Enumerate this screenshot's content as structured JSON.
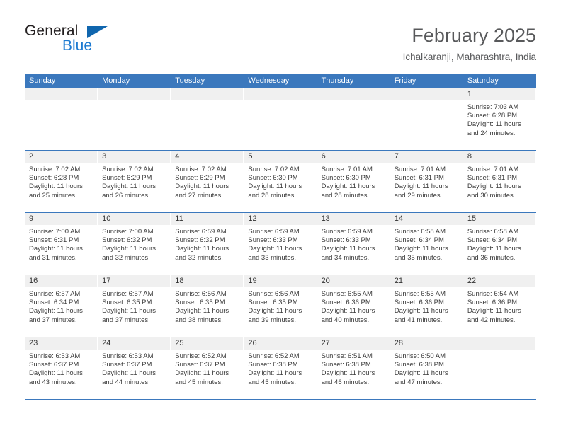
{
  "brand": {
    "name_part1": "General",
    "name_part2": "Blue",
    "triangle_color": "#1066ae",
    "blue_color": "#1c7ad1"
  },
  "header": {
    "title": "February 2025",
    "location": "Ichalkaranji, Maharashtra, India",
    "accent_color": "#3b78bd",
    "title_color": "#58595b"
  },
  "calendar": {
    "weekday_headers": [
      "Sunday",
      "Monday",
      "Tuesday",
      "Wednesday",
      "Thursday",
      "Friday",
      "Saturday"
    ],
    "weeks": [
      [
        {
          "day": "",
          "sunrise": "",
          "sunset": "",
          "daylight1": "",
          "daylight2": ""
        },
        {
          "day": "",
          "sunrise": "",
          "sunset": "",
          "daylight1": "",
          "daylight2": ""
        },
        {
          "day": "",
          "sunrise": "",
          "sunset": "",
          "daylight1": "",
          "daylight2": ""
        },
        {
          "day": "",
          "sunrise": "",
          "sunset": "",
          "daylight1": "",
          "daylight2": ""
        },
        {
          "day": "",
          "sunrise": "",
          "sunset": "",
          "daylight1": "",
          "daylight2": ""
        },
        {
          "day": "",
          "sunrise": "",
          "sunset": "",
          "daylight1": "",
          "daylight2": ""
        },
        {
          "day": "1",
          "sunrise": "Sunrise: 7:03 AM",
          "sunset": "Sunset: 6:28 PM",
          "daylight1": "Daylight: 11 hours",
          "daylight2": "and 24 minutes."
        }
      ],
      [
        {
          "day": "2",
          "sunrise": "Sunrise: 7:02 AM",
          "sunset": "Sunset: 6:28 PM",
          "daylight1": "Daylight: 11 hours",
          "daylight2": "and 25 minutes."
        },
        {
          "day": "3",
          "sunrise": "Sunrise: 7:02 AM",
          "sunset": "Sunset: 6:29 PM",
          "daylight1": "Daylight: 11 hours",
          "daylight2": "and 26 minutes."
        },
        {
          "day": "4",
          "sunrise": "Sunrise: 7:02 AM",
          "sunset": "Sunset: 6:29 PM",
          "daylight1": "Daylight: 11 hours",
          "daylight2": "and 27 minutes."
        },
        {
          "day": "5",
          "sunrise": "Sunrise: 7:02 AM",
          "sunset": "Sunset: 6:30 PM",
          "daylight1": "Daylight: 11 hours",
          "daylight2": "and 28 minutes."
        },
        {
          "day": "6",
          "sunrise": "Sunrise: 7:01 AM",
          "sunset": "Sunset: 6:30 PM",
          "daylight1": "Daylight: 11 hours",
          "daylight2": "and 28 minutes."
        },
        {
          "day": "7",
          "sunrise": "Sunrise: 7:01 AM",
          "sunset": "Sunset: 6:31 PM",
          "daylight1": "Daylight: 11 hours",
          "daylight2": "and 29 minutes."
        },
        {
          "day": "8",
          "sunrise": "Sunrise: 7:01 AM",
          "sunset": "Sunset: 6:31 PM",
          "daylight1": "Daylight: 11 hours",
          "daylight2": "and 30 minutes."
        }
      ],
      [
        {
          "day": "9",
          "sunrise": "Sunrise: 7:00 AM",
          "sunset": "Sunset: 6:31 PM",
          "daylight1": "Daylight: 11 hours",
          "daylight2": "and 31 minutes."
        },
        {
          "day": "10",
          "sunrise": "Sunrise: 7:00 AM",
          "sunset": "Sunset: 6:32 PM",
          "daylight1": "Daylight: 11 hours",
          "daylight2": "and 32 minutes."
        },
        {
          "day": "11",
          "sunrise": "Sunrise: 6:59 AM",
          "sunset": "Sunset: 6:32 PM",
          "daylight1": "Daylight: 11 hours",
          "daylight2": "and 32 minutes."
        },
        {
          "day": "12",
          "sunrise": "Sunrise: 6:59 AM",
          "sunset": "Sunset: 6:33 PM",
          "daylight1": "Daylight: 11 hours",
          "daylight2": "and 33 minutes."
        },
        {
          "day": "13",
          "sunrise": "Sunrise: 6:59 AM",
          "sunset": "Sunset: 6:33 PM",
          "daylight1": "Daylight: 11 hours",
          "daylight2": "and 34 minutes."
        },
        {
          "day": "14",
          "sunrise": "Sunrise: 6:58 AM",
          "sunset": "Sunset: 6:34 PM",
          "daylight1": "Daylight: 11 hours",
          "daylight2": "and 35 minutes."
        },
        {
          "day": "15",
          "sunrise": "Sunrise: 6:58 AM",
          "sunset": "Sunset: 6:34 PM",
          "daylight1": "Daylight: 11 hours",
          "daylight2": "and 36 minutes."
        }
      ],
      [
        {
          "day": "16",
          "sunrise": "Sunrise: 6:57 AM",
          "sunset": "Sunset: 6:34 PM",
          "daylight1": "Daylight: 11 hours",
          "daylight2": "and 37 minutes."
        },
        {
          "day": "17",
          "sunrise": "Sunrise: 6:57 AM",
          "sunset": "Sunset: 6:35 PM",
          "daylight1": "Daylight: 11 hours",
          "daylight2": "and 37 minutes."
        },
        {
          "day": "18",
          "sunrise": "Sunrise: 6:56 AM",
          "sunset": "Sunset: 6:35 PM",
          "daylight1": "Daylight: 11 hours",
          "daylight2": "and 38 minutes."
        },
        {
          "day": "19",
          "sunrise": "Sunrise: 6:56 AM",
          "sunset": "Sunset: 6:35 PM",
          "daylight1": "Daylight: 11 hours",
          "daylight2": "and 39 minutes."
        },
        {
          "day": "20",
          "sunrise": "Sunrise: 6:55 AM",
          "sunset": "Sunset: 6:36 PM",
          "daylight1": "Daylight: 11 hours",
          "daylight2": "and 40 minutes."
        },
        {
          "day": "21",
          "sunrise": "Sunrise: 6:55 AM",
          "sunset": "Sunset: 6:36 PM",
          "daylight1": "Daylight: 11 hours",
          "daylight2": "and 41 minutes."
        },
        {
          "day": "22",
          "sunrise": "Sunrise: 6:54 AM",
          "sunset": "Sunset: 6:36 PM",
          "daylight1": "Daylight: 11 hours",
          "daylight2": "and 42 minutes."
        }
      ],
      [
        {
          "day": "23",
          "sunrise": "Sunrise: 6:53 AM",
          "sunset": "Sunset: 6:37 PM",
          "daylight1": "Daylight: 11 hours",
          "daylight2": "and 43 minutes."
        },
        {
          "day": "24",
          "sunrise": "Sunrise: 6:53 AM",
          "sunset": "Sunset: 6:37 PM",
          "daylight1": "Daylight: 11 hours",
          "daylight2": "and 44 minutes."
        },
        {
          "day": "25",
          "sunrise": "Sunrise: 6:52 AM",
          "sunset": "Sunset: 6:37 PM",
          "daylight1": "Daylight: 11 hours",
          "daylight2": "and 45 minutes."
        },
        {
          "day": "26",
          "sunrise": "Sunrise: 6:52 AM",
          "sunset": "Sunset: 6:38 PM",
          "daylight1": "Daylight: 11 hours",
          "daylight2": "and 45 minutes."
        },
        {
          "day": "27",
          "sunrise": "Sunrise: 6:51 AM",
          "sunset": "Sunset: 6:38 PM",
          "daylight1": "Daylight: 11 hours",
          "daylight2": "and 46 minutes."
        },
        {
          "day": "28",
          "sunrise": "Sunrise: 6:50 AM",
          "sunset": "Sunset: 6:38 PM",
          "daylight1": "Daylight: 11 hours",
          "daylight2": "and 47 minutes."
        },
        {
          "day": "",
          "sunrise": "",
          "sunset": "",
          "daylight1": "",
          "daylight2": ""
        }
      ]
    ]
  }
}
